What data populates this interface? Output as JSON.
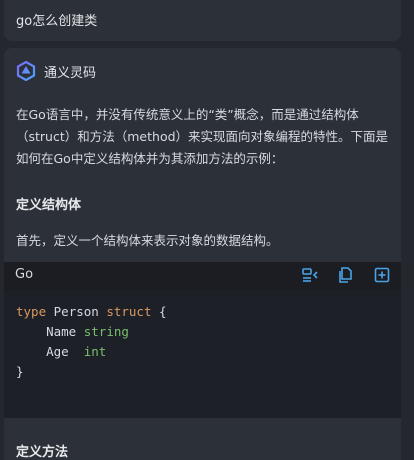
{
  "user_message": "go怎么创建类",
  "assistant": {
    "name": "通义灵码",
    "logo_icon": "tongyi-lingma-logo"
  },
  "answer": {
    "intro": "在Go语言中，并没有传统意义上的“类”概念，而是通过结构体（struct）和方法（method）来实现面向对象编程的特性。下面是如何在Go中定义结构体并为其添加方法的示例：",
    "section1_title": "定义结构体",
    "section1_text": "首先，定义一个结构体来表示对象的数据结构。",
    "code": {
      "language": "Go",
      "actions": [
        "insert-at-cursor-icon",
        "copy-icon",
        "new-file-icon"
      ],
      "line1_kw1": "type",
      "line1_name": "Person",
      "line1_kw2": "struct",
      "line1_brace": "{",
      "line2_field": "Name",
      "line2_type": "string",
      "line3_field": "Age",
      "line3_type": "int",
      "line4_brace": "}"
    },
    "section2_title": "定义方法"
  },
  "colors": {
    "background": "#24272e",
    "card": "#2c3038",
    "code_bg": "#1e2027",
    "keyword": "#d8995f",
    "type": "#79bf6b",
    "icon_accent": "#4aa3e8"
  }
}
